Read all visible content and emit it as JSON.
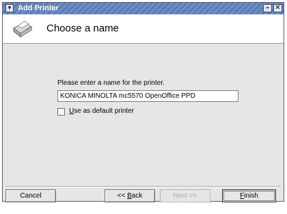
{
  "window": {
    "title": "Add Printer",
    "menu_glyph": "▾",
    "minimize_glyph": "–",
    "close_glyph": "✕"
  },
  "header": {
    "title": "Choose a name",
    "icon": "printer-icon"
  },
  "form": {
    "prompt": "Please enter a name for the printer.",
    "name_value": "KONICA MINOLTA mc5570 OpenOffice PPD",
    "default_checkbox": {
      "mnemonic": "U",
      "rest": "se as default printer",
      "checked": false
    }
  },
  "buttons": {
    "cancel": "Cancel",
    "back_prefix": "<< ",
    "back_mnemonic": "B",
    "back_rest": "ack",
    "next": "Next >>",
    "finish_mnemonic": "F",
    "finish_rest": "inish"
  },
  "colors": {
    "titlebar": "#6f8fc4",
    "window_bg": "#e6e6e6",
    "header_bg": "#ffffff",
    "disabled_text": "#a9a9a9"
  }
}
